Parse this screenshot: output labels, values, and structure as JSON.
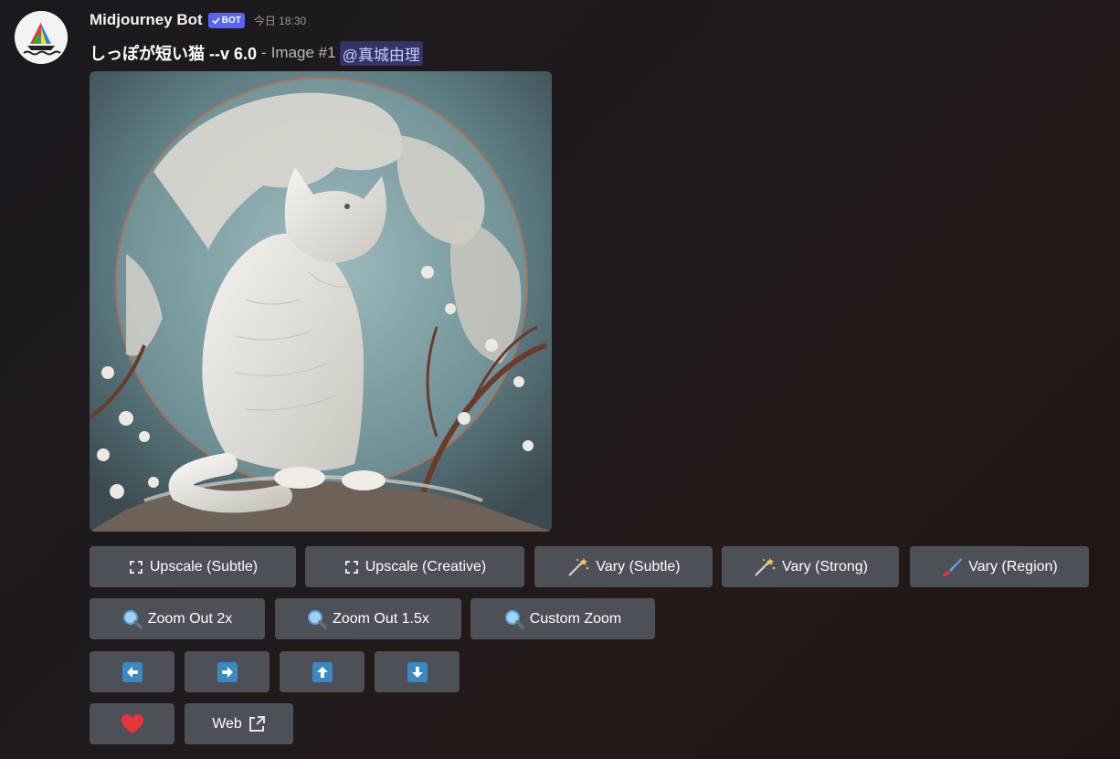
{
  "message": {
    "author": "Midjourney Bot",
    "badge_label": "BOT",
    "timestamp": "今日 18:30",
    "prompt_text": "しっぽが短い猫 --v 6.0",
    "separator": "-",
    "image_label": "Image #1",
    "mention": "@真城由理"
  },
  "buttons": {
    "row1": [
      "Upscale (Subtle)",
      "Upscale (Creative)",
      "Vary (Subtle)",
      "Vary (Strong)",
      "Vary (Region)"
    ],
    "row2": [
      "Zoom Out 2x",
      "Zoom Out 1.5x",
      "Custom Zoom"
    ],
    "web_label": "Web"
  },
  "icons": {
    "upscale": "expand-icon",
    "vary": "magic-wand-icon",
    "region": "paintbrush-icon",
    "zoom": "magnifier-icon",
    "pan_left": "arrow-left-icon",
    "pan_right": "arrow-right-icon",
    "pan_up": "arrow-up-icon",
    "pan_down": "arrow-down-icon",
    "favorite": "heart-icon",
    "external": "external-link-icon"
  },
  "colors": {
    "button_bg": "#4e5058",
    "mention_bg": "#5865f2",
    "heart": "#e8343c",
    "arrow_blue": "#3b88c3"
  }
}
